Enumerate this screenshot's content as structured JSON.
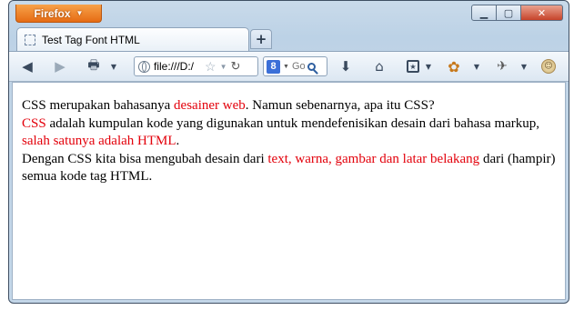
{
  "window": {
    "app_menu_label": "Firefox"
  },
  "tab": {
    "title": "Test Tag Font HTML"
  },
  "toolbar": {
    "url": "file:///D:/",
    "search_placeholder": "Go"
  },
  "content": {
    "p1_a": "CSS merupakan bahasanya ",
    "p1_red": "desainer web",
    "p1_b": ". Namun sebenarnya, apa itu CSS?",
    "p2_red": "CSS",
    "p2_a": " adalah kumpulan kode yang digunakan untuk mendefenisikan desain dari bahasa markup, ",
    "p2_red2": "salah satunya adalah HTML",
    "p2_b": ".",
    "p3_a": "Dengan CSS kita bisa mengubah desain dari ",
    "p3_red": "text, warna, gambar dan latar belakang",
    "p3_b": " dari (hampir) semua kode tag HTML."
  },
  "colors": {
    "highlight": "#e3000b",
    "firefox_button": "#e66c14"
  },
  "icons": [
    "page-icon",
    "back-icon",
    "forward-icon",
    "print-icon",
    "globe-icon",
    "star-icon",
    "reload-icon",
    "google-icon",
    "search-icon",
    "download-icon",
    "home-icon",
    "bookmarks-icon",
    "addon-icon",
    "smiley-icon"
  ]
}
